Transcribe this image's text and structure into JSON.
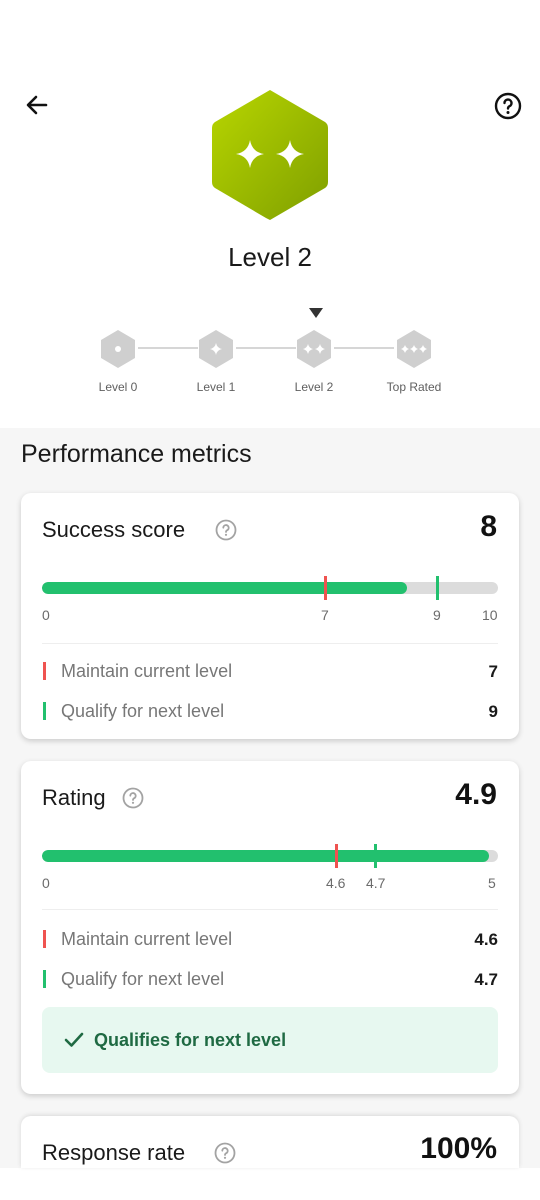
{
  "header": {
    "level_title": "Level 2",
    "badge_color": "#9cc000",
    "steps": [
      {
        "label": "Level 0",
        "dots": "•"
      },
      {
        "label": "Level 1",
        "dots": "✦"
      },
      {
        "label": "Level 2",
        "dots": "✦✦"
      },
      {
        "label": "Top Rated",
        "dots": "✦✦✦"
      }
    ],
    "current_step_index": 2
  },
  "section_title": "Performance metrics",
  "colors": {
    "green": "#22c06e",
    "red": "#ef5350",
    "track": "#dcdcdc",
    "qualify_bg": "#e7f8f0",
    "qualify_text": "#1f6a43"
  },
  "cards": {
    "success": {
      "title": "Success score",
      "value": "8",
      "progress": 8,
      "min": 0,
      "max": 10,
      "ticks": {
        "min": "0",
        "maintain": "7",
        "qualify": "9",
        "max": "10"
      },
      "maintain": {
        "label": "Maintain current level",
        "value": "7"
      },
      "qualify": {
        "label": "Qualify for next level",
        "value": "9"
      }
    },
    "rating": {
      "title": "Rating",
      "value": "4.9",
      "progress": 4.9,
      "min": 0,
      "max": 5,
      "ticks": {
        "min": "0",
        "maintain": "4.6",
        "qualify": "4.7",
        "max": "5"
      },
      "maintain": {
        "label": "Maintain current level",
        "value": "4.6"
      },
      "qualify": {
        "label": "Qualify for next level",
        "value": "4.7"
      },
      "status": "Qualifies for next level"
    },
    "response": {
      "title": "Response rate",
      "value": "100%"
    }
  }
}
